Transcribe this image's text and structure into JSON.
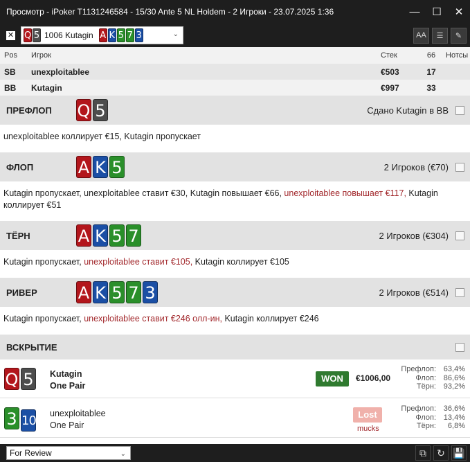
{
  "window": {
    "title": "Просмотр - iPoker T1131246584 - 15/30 Ante 5 NL Holdem - 2 Игроки - 23.07.2025 1:36",
    "minimize_glyph": "—",
    "maximize_glyph": "☐",
    "close_glyph": "✕"
  },
  "toolbar": {
    "close_glyph": "✕",
    "hand_label": "1006 Kutagin",
    "hero_cards": [
      {
        "rank": "Q",
        "suit": "h"
      },
      {
        "rank": "5",
        "suit": "s"
      }
    ],
    "board_cards": [
      {
        "rank": "A",
        "suit": "h"
      },
      {
        "rank": "K",
        "suit": "d"
      },
      {
        "rank": "5",
        "suit": "c"
      },
      {
        "rank": "7",
        "suit": "c"
      },
      {
        "rank": "3",
        "suit": "d"
      }
    ],
    "icons": [
      "font-size-icon",
      "list-icon",
      "edit-icon"
    ],
    "icon_glyphs": [
      "AA",
      "☰",
      "✎"
    ]
  },
  "players": {
    "headers": {
      "pos": "Pos",
      "player": "Игрок",
      "stack": "Стек",
      "col66": "66",
      "notes": "Нотсы"
    },
    "rows": [
      {
        "pos": "SB",
        "name": "unexploitablee",
        "stack": "€503",
        "col66": "17"
      },
      {
        "pos": "BB",
        "name": "Kutagin",
        "stack": "€997",
        "col66": "33"
      }
    ]
  },
  "streets": {
    "preflop": {
      "name": "ПРЕФЛОП",
      "cards": [
        {
          "rank": "Q",
          "suit": "h"
        },
        {
          "rank": "5",
          "suit": "s"
        }
      ],
      "info": "Сдано Kutagin в BB",
      "actions": [
        {
          "text": "unexploitablee коллирует €15, Kutagin пропускает",
          "red": false
        }
      ]
    },
    "flop": {
      "name": "ФЛОП",
      "cards": [
        {
          "rank": "A",
          "suit": "h"
        },
        {
          "rank": "K",
          "suit": "d"
        },
        {
          "rank": "5",
          "suit": "c"
        }
      ],
      "info": "2 Игроков (€70)",
      "actions": [
        {
          "text": "Kutagin пропускает, unexploitablee ставит €30, Kutagin повышает €66, ",
          "red": false
        },
        {
          "text": "unexploitablee повышает €117, ",
          "red": true
        },
        {
          "text": "Kutagin коллирует €51",
          "red": false
        }
      ]
    },
    "turn": {
      "name": "ТЁРН",
      "cards": [
        {
          "rank": "A",
          "suit": "h"
        },
        {
          "rank": "K",
          "suit": "d"
        },
        {
          "rank": "5",
          "suit": "c"
        },
        {
          "rank": "7",
          "suit": "c"
        }
      ],
      "info": "2 Игроков (€304)",
      "actions": [
        {
          "text": "Kutagin пропускает, ",
          "red": false
        },
        {
          "text": "unexploitablee ставит €105, ",
          "red": true
        },
        {
          "text": "Kutagin коллирует €105",
          "red": false
        }
      ]
    },
    "river": {
      "name": "РИВЕР",
      "cards": [
        {
          "rank": "A",
          "suit": "h"
        },
        {
          "rank": "K",
          "suit": "d"
        },
        {
          "rank": "5",
          "suit": "c"
        },
        {
          "rank": "7",
          "suit": "c"
        },
        {
          "rank": "3",
          "suit": "d"
        }
      ],
      "info": "2 Игроков (€514)",
      "actions": [
        {
          "text": "Kutagin пропускает, ",
          "red": false
        },
        {
          "text": "unexploitablee ставит €246 олл-ин, ",
          "red": true
        },
        {
          "text": "Kutagin коллирует €246",
          "red": false
        }
      ]
    }
  },
  "showdown": {
    "name": "ВСКРЫТИЕ",
    "players": [
      {
        "name": "Kutagin",
        "hand": "One Pair",
        "cards": [
          {
            "rank": "Q",
            "suit": "h"
          },
          {
            "rank": "5",
            "suit": "s"
          }
        ],
        "result": "WON",
        "amount": "€1006,00",
        "mucks": "",
        "stats": [
          {
            "label": "Префлоп:",
            "value": "63,4%"
          },
          {
            "label": "Флоп:",
            "value": "86,6%"
          },
          {
            "label": "Тёрн:",
            "value": "93,2%"
          }
        ]
      },
      {
        "name": "unexploitablee",
        "hand": "One Pair",
        "cards": [
          {
            "rank": "3",
            "suit": "c"
          },
          {
            "rank": "10",
            "suit": "d"
          }
        ],
        "result": "Lost",
        "amount": "",
        "mucks": "mucks",
        "stats": [
          {
            "label": "Префлоп:",
            "value": "36,6%"
          },
          {
            "label": "Флоп:",
            "value": "13,4%"
          },
          {
            "label": "Тёрн:",
            "value": "6,8%"
          }
        ]
      }
    ]
  },
  "bottombar": {
    "review_value": "For Review",
    "icons": [
      "copy-icon",
      "refresh-icon",
      "save-icon"
    ],
    "icon_glyphs": [
      "⧉",
      "↻",
      "💾"
    ]
  }
}
